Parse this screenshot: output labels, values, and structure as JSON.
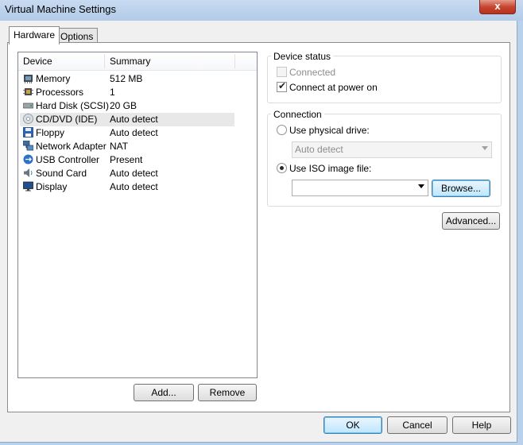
{
  "window": {
    "title": "Virtual Machine Settings",
    "close_glyph": "x"
  },
  "tabs": [
    {
      "label": "Hardware",
      "active": true
    },
    {
      "label": "Options",
      "active": false
    }
  ],
  "device_list": {
    "columns": [
      "Device",
      "Summary"
    ],
    "rows": [
      {
        "icon": "memory-icon",
        "device": "Memory",
        "summary": "512 MB"
      },
      {
        "icon": "processor-icon",
        "device": "Processors",
        "summary": "1"
      },
      {
        "icon": "hard-disk-icon",
        "device": "Hard Disk (SCSI)",
        "summary": "20 GB"
      },
      {
        "icon": "cd-dvd-icon",
        "device": "CD/DVD (IDE)",
        "summary": "Auto detect",
        "selected": true
      },
      {
        "icon": "floppy-icon",
        "device": "Floppy",
        "summary": "Auto detect"
      },
      {
        "icon": "network-adapter-icon",
        "device": "Network Adapter",
        "summary": "NAT"
      },
      {
        "icon": "usb-icon",
        "device": "USB Controller",
        "summary": "Present"
      },
      {
        "icon": "sound-card-icon",
        "device": "Sound Card",
        "summary": "Auto detect"
      },
      {
        "icon": "display-icon",
        "device": "Display",
        "summary": "Auto detect"
      }
    ]
  },
  "list_buttons": {
    "add": "Add...",
    "remove": "Remove"
  },
  "device_status": {
    "label": "Device status",
    "connected": {
      "label": "Connected",
      "checked": false,
      "enabled": false
    },
    "connect_at_power_on": {
      "label": "Connect at power on",
      "checked": true
    }
  },
  "connection": {
    "label": "Connection",
    "physical_drive": {
      "label": "Use physical drive:",
      "selected": false,
      "drive_value": "Auto detect"
    },
    "iso_image": {
      "label": "Use ISO image file:",
      "selected": true,
      "file_value": ""
    },
    "browse": "Browse..."
  },
  "advanced_button": "Advanced...",
  "footer": {
    "ok": "OK",
    "cancel": "Cancel",
    "help": "Help"
  },
  "colors": {
    "accent": "#3c7fb1",
    "selection": "#e8e8e8",
    "titlebar": "#b9d1ea"
  }
}
